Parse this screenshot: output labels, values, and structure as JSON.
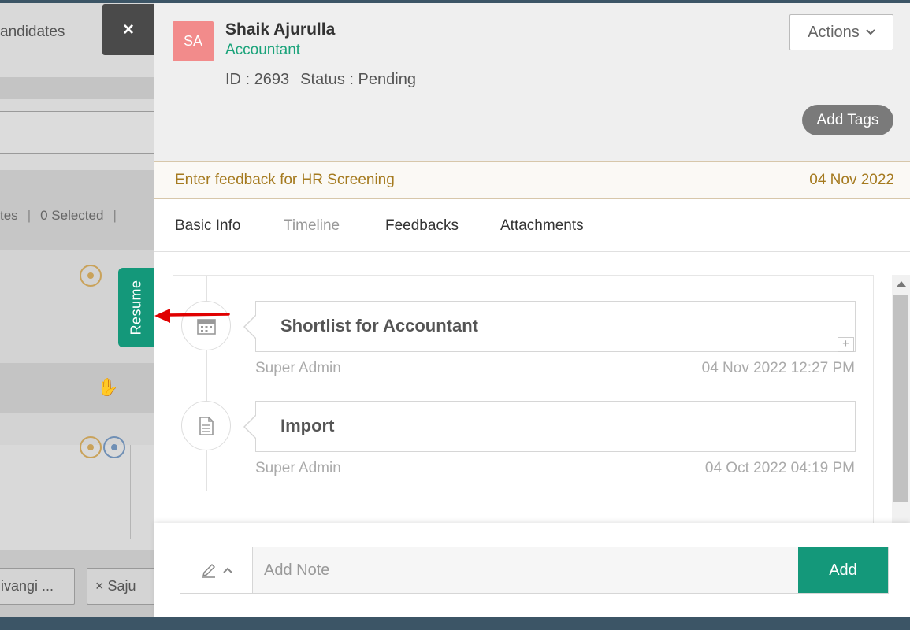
{
  "background": {
    "tab_label": "andidates",
    "filter_left": "tes",
    "filter_selected": "0 Selected",
    "chips": [
      {
        "label": "ivangi ..."
      },
      {
        "label": "× Saju"
      }
    ]
  },
  "overlay": {
    "close_label": "×",
    "resume_tab_label": "Resume"
  },
  "candidate": {
    "initials": "SA",
    "name": "Shaik Ajurulla",
    "role": "Accountant",
    "id_text": "ID : 2693",
    "status_text": "Status : Pending",
    "actions_label": "Actions",
    "add_tags_label": "Add Tags"
  },
  "feedback": {
    "prompt": "Enter feedback for HR Screening",
    "date": "04 Nov 2022"
  },
  "tabs": [
    {
      "label": "Basic Info"
    },
    {
      "label": "Timeline"
    },
    {
      "label": "Feedbacks"
    },
    {
      "label": "Attachments"
    }
  ],
  "timeline": [
    {
      "title": "Shortlist for Accountant",
      "by": "Super Admin",
      "when": "04 Nov 2022 12:27 PM",
      "icon": "calendar-icon"
    },
    {
      "title": "Import",
      "by": "Super Admin",
      "when": "04 Oct 2022 04:19 PM",
      "icon": "document-icon"
    }
  ],
  "note": {
    "placeholder": "Add Note",
    "add_label": "Add"
  },
  "colors": {
    "accent": "#14987a",
    "role_green": "#1aa37a",
    "avatar_bg": "#f28b8b",
    "feedback_text": "#a57a1f",
    "annotation_red": "#e00000"
  }
}
